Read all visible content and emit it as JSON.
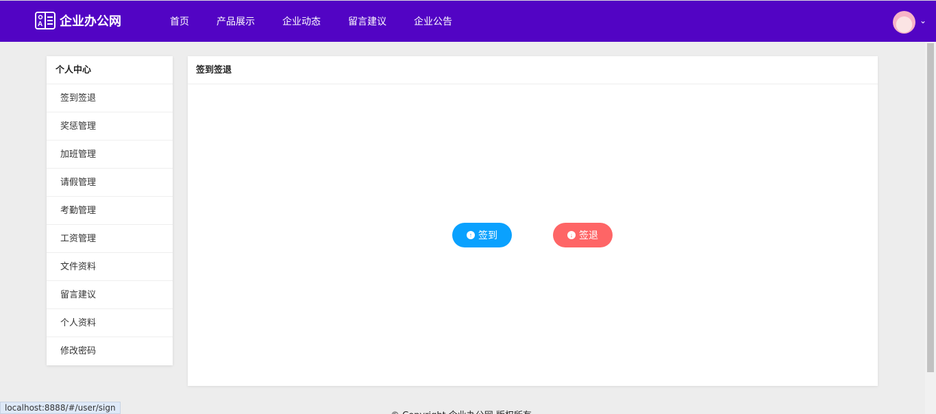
{
  "header": {
    "logo": "企业办公网",
    "nav": [
      "首页",
      "产品展示",
      "企业动态",
      "留言建议",
      "企业公告"
    ]
  },
  "sidebar": {
    "title": "个人中心",
    "items": [
      "签到签退",
      "奖惩管理",
      "加班管理",
      "请假管理",
      "考勤管理",
      "工资管理",
      "文件资料",
      "留言建议",
      "个人资料",
      "修改密码"
    ]
  },
  "main": {
    "title": "签到签退",
    "sign_in": "签到",
    "sign_out": "签退"
  },
  "footer": "© Copyright 企业办公网 版权所有",
  "status_url": "localhost:8888/#/user/sign",
  "colors": {
    "header": "#5204c4",
    "sign_in": "#0aa1fe",
    "sign_out": "#fe6566"
  }
}
